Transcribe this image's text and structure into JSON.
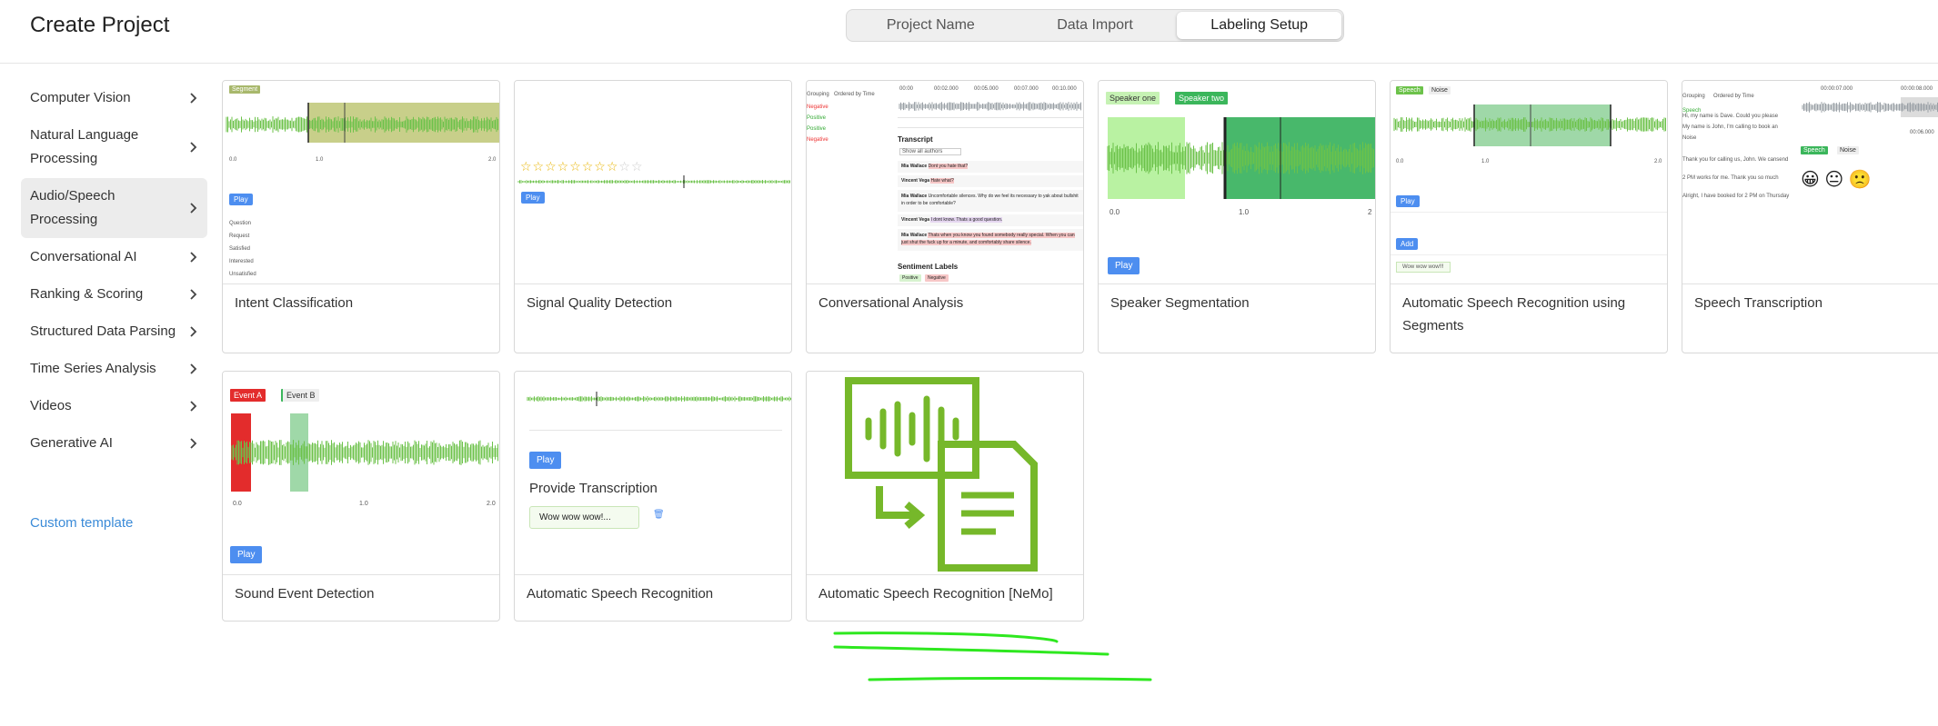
{
  "header": {
    "title": "Create Project",
    "steps": [
      "Project Name",
      "Data Import",
      "Labeling Setup"
    ],
    "active_step": 2
  },
  "sidebar": {
    "items": [
      {
        "label": "Computer Vision"
      },
      {
        "label": "Natural Language Processing"
      },
      {
        "label": "Audio/Speech Processing",
        "active": true
      },
      {
        "label": "Conversational AI"
      },
      {
        "label": "Ranking & Scoring"
      },
      {
        "label": "Structured Data Parsing"
      },
      {
        "label": "Time Series Analysis"
      },
      {
        "label": "Videos"
      },
      {
        "label": "Generative AI"
      }
    ],
    "custom_template": "Custom template"
  },
  "templates": [
    {
      "title": "Intent Classification"
    },
    {
      "title": "Signal Quality Detection"
    },
    {
      "title": "Conversational Analysis"
    },
    {
      "title": "Speaker Segmentation"
    },
    {
      "title": "Automatic Speech Recognition using Segments"
    },
    {
      "title": "Speech Transcription"
    },
    {
      "title": "Sound Event Detection"
    },
    {
      "title": "Automatic Speech Recognition"
    },
    {
      "title": "Automatic Speech Recognition [NeMo]"
    }
  ],
  "previews": {
    "intent": {
      "region_label": "Segment",
      "play": "Play",
      "options": [
        "Question",
        "Request",
        "Satisfied",
        "Interested",
        "Unsatisfied"
      ],
      "ticks": [
        "0.0",
        "1.0",
        "2.0"
      ]
    },
    "signal": {
      "play": "Play",
      "stars": 10,
      "filled": 8
    },
    "conversational": {
      "toolbar": [
        "Grouping",
        "Ordered by Time"
      ],
      "times": [
        "00:00",
        "00:02.000",
        "00:05.000",
        "00:07.000",
        "00:10.000"
      ],
      "transcript_title": "Transcript",
      "filter": "Show all authors",
      "rows": [
        {
          "author": "Mia Wallace",
          "text": "Dont you hate that?"
        },
        {
          "author": "Vincent Vega",
          "text": "Hate what?"
        },
        {
          "author": "Mia Wallace",
          "text": "Uncomfortable silences. Why do we feel its necessary to yak about bullshit in order to be comfortable?"
        },
        {
          "author": "Vincent Vega",
          "text": "I dont know. Thats a good question."
        },
        {
          "author": "Mia Wallace",
          "text": "Thats when you know you found somebody really special. When you can just shut the fuck up for a minute, and comfortably share silence."
        }
      ],
      "sentiment_title": "Sentiment Labels",
      "sentiments": [
        "Positive",
        "Negative"
      ],
      "side_labels": [
        "Negative",
        "Positive",
        "Positive",
        "Negative"
      ]
    },
    "speaker": {
      "labels": [
        "Speaker one",
        "Speaker two"
      ],
      "play": "Play",
      "ticks": [
        "0.0",
        "1.0",
        "2"
      ]
    },
    "asr_segments": {
      "labels": [
        "Speech",
        "Noise"
      ],
      "play": "Play",
      "add": "Add",
      "text": "Wow wow wow!!!",
      "ticks": [
        "0.0",
        "1.0",
        "2.0"
      ]
    },
    "speech_transcription": {
      "toolbar": [
        "Grouping",
        "Ordered by Time"
      ],
      "times": [
        "00:00:07.000",
        "00:00:08.000"
      ],
      "labels": [
        "Speech",
        "Noise"
      ],
      "lines": [
        "Hi, my name is Dave. Could you please",
        "My name is John, I'm calling to book an",
        "Noise",
        "Thank you for calling us, John. We cansend",
        "2 PM works for me. Thank you so much",
        "Alright, I have booked for 2 PM on Thursday"
      ],
      "speech_tag": "Speech",
      "time_readout": "00:06.000"
    },
    "sound_event": {
      "labels": [
        "Event A",
        "Event B"
      ],
      "play": "Play",
      "ticks": [
        "0.0",
        "1.0",
        "2.0"
      ]
    },
    "asr": {
      "play": "Play",
      "heading": "Provide Transcription",
      "text": "Wow wow wow!..."
    }
  },
  "colors": {
    "accent_blue": "#4d8ef0",
    "link_blue": "#3b8bd8",
    "wave_green": "#6cc24a",
    "wave_gray": "#9aa0a6",
    "nemo_green": "#76b82a",
    "scribble_green": "#2ee81f"
  }
}
